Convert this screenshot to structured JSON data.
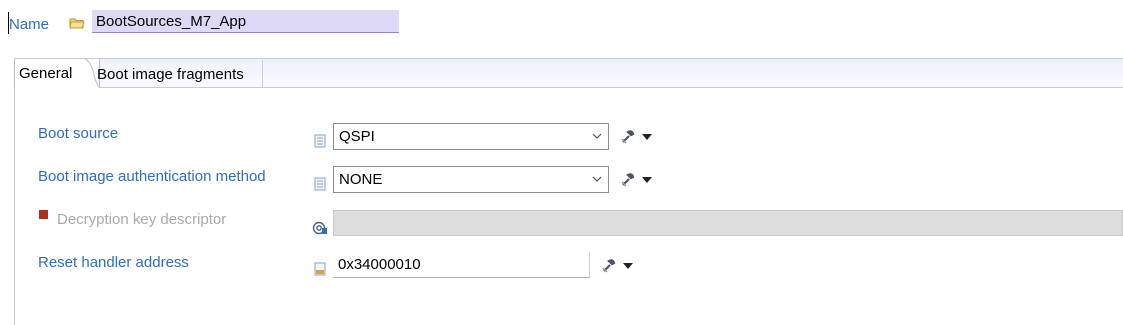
{
  "header": {
    "name_label": "Name",
    "name_value": "BootSources_M7_App"
  },
  "tabs": [
    {
      "label": "General",
      "selected": true
    },
    {
      "label": "Boot image fragments",
      "selected": false
    }
  ],
  "fields": {
    "boot_source": {
      "label": "Boot source",
      "value": "QSPI"
    },
    "auth_method": {
      "label": "Boot image authentication method",
      "value": "NONE"
    },
    "decryption_key": {
      "label": "Decryption key descriptor",
      "value": "",
      "enabled": false
    },
    "reset_handler": {
      "label": "Reset handler address",
      "value": "0x34000010"
    }
  },
  "colors": {
    "label_blue": "#2f6dc0",
    "name_field_bg": "#ded9f7",
    "disabled_gray": "#a9a9a9",
    "error_red": "#b03020"
  },
  "icons": [
    "folder-icon",
    "document-icon",
    "at-icon",
    "hex-icon",
    "wrench-icon",
    "dropdown-arrow-icon",
    "chevron-down-icon"
  ]
}
